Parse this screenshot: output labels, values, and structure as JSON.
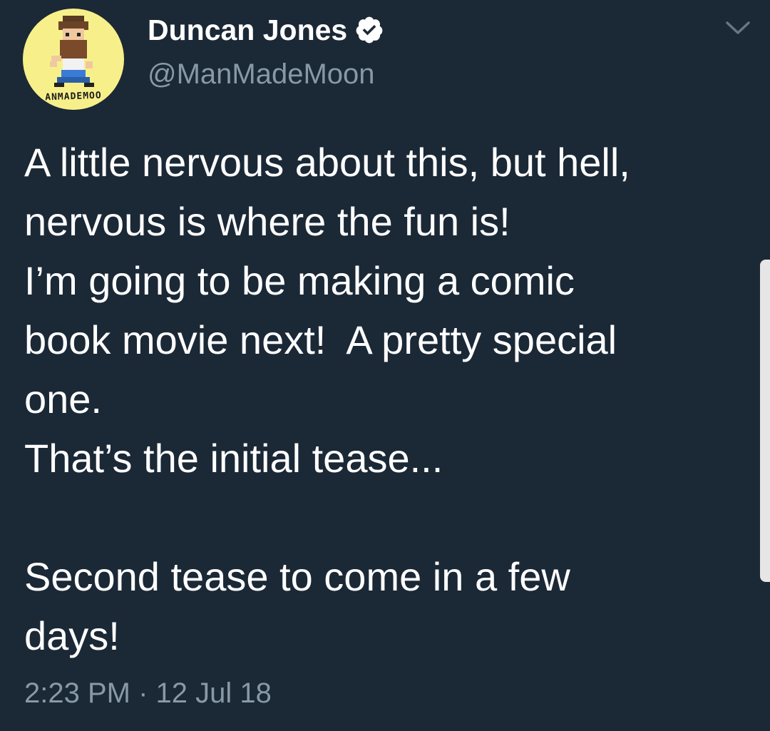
{
  "user": {
    "display_name": "Duncan Jones",
    "handle": "@ManMadeMoon",
    "avatar_text": "ANMADEMOO",
    "verified": true,
    "avatar_icon": "pixel-art-avatar-icon"
  },
  "tweet": {
    "lines": [
      "A little nervous about this, but hell,",
      "nervous is where the fun is!",
      "I’m going to be making a comic",
      "book movie next!  A pretty special",
      "one.",
      "That’s the initial tease...",
      "",
      "Second tease to come in a few",
      "days!"
    ],
    "timestamp": "2:23 PM · 12 Jul 18"
  },
  "icons": {
    "verified": "verified-badge-icon",
    "menu": "chevron-down-icon"
  },
  "colors": {
    "background": "#1b2836",
    "text": "#ffffff",
    "secondary_text": "#8899a6",
    "avatar_bg": "#f7f08a"
  }
}
